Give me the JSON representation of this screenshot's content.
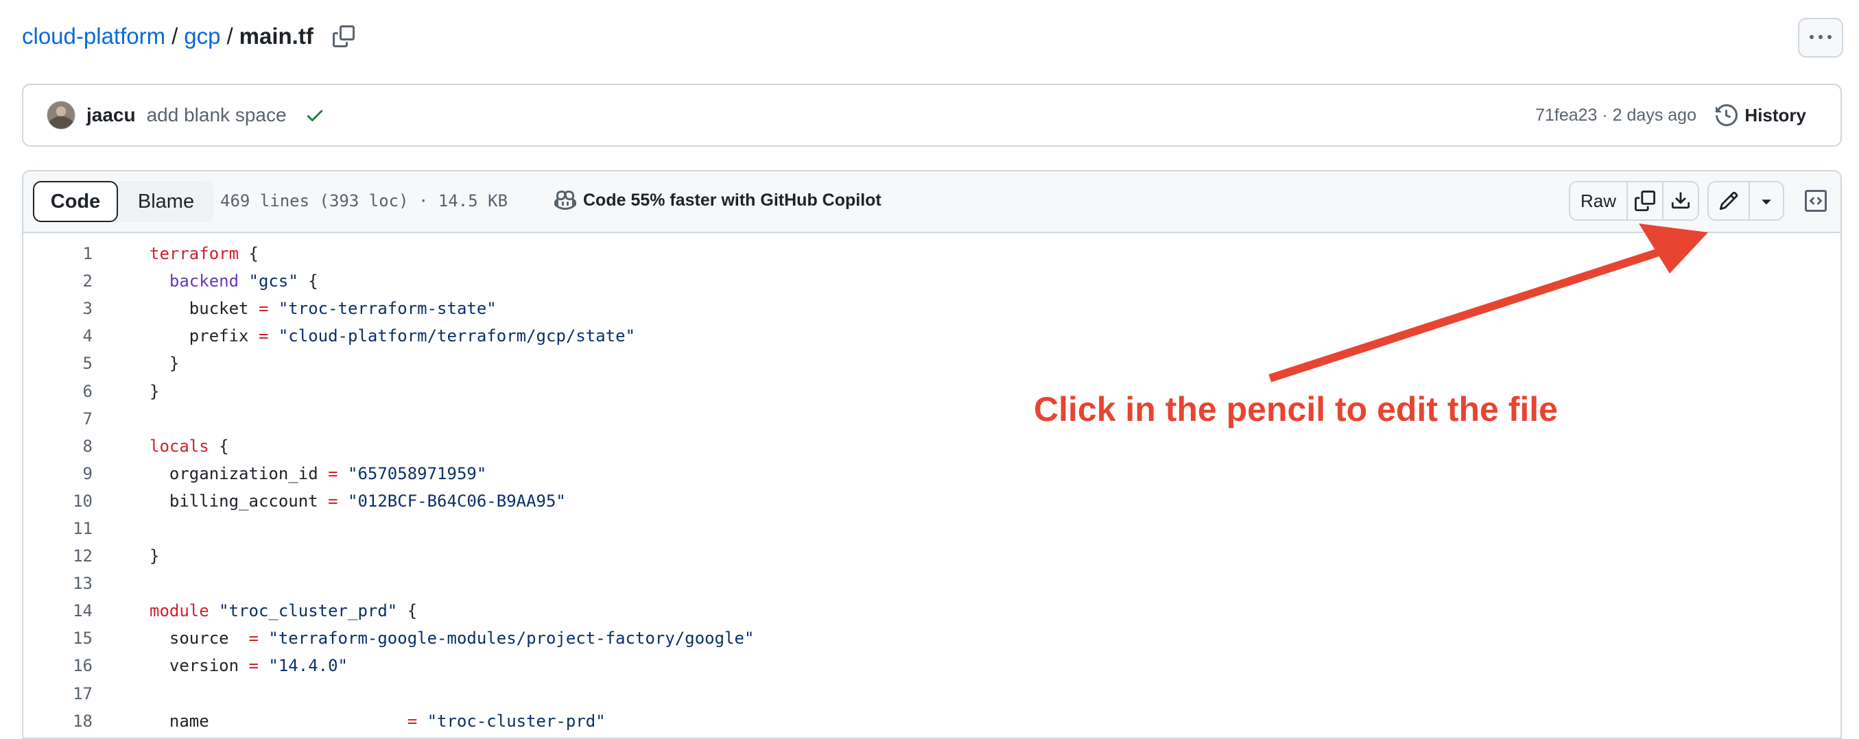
{
  "breadcrumb": {
    "repo": "cloud-platform",
    "folder": "gcp",
    "file": "main.tf",
    "separator": "/"
  },
  "commit": {
    "author": "jaacu",
    "message": "add blank space",
    "hash": "71fea23",
    "time": "2 days ago",
    "history_label": "History"
  },
  "viewer": {
    "tabs": {
      "code": "Code",
      "blame": "Blame"
    },
    "file_info": "469 lines (393 loc) · 14.5 KB",
    "copilot": "Code 55% faster with GitHub Copilot",
    "raw": "Raw"
  },
  "annotation": {
    "text": "Click in the pencil to edit the file",
    "color": "#e74531"
  },
  "colors": {
    "link": "#0969da",
    "keyword": "#cf222e",
    "block_label": "#6639ba",
    "string": "#0a3069",
    "check": "#1a7f37"
  },
  "icons": [
    "copy-icon",
    "kebab-icon",
    "check-icon",
    "history-icon",
    "copilot-icon",
    "copy-icon",
    "download-icon",
    "pencil-icon",
    "triangle-down-icon",
    "code-square-icon"
  ],
  "code": {
    "lines": [
      [
        [
          "terraform",
          "kw"
        ],
        [
          " {",
          ""
        ]
      ],
      [
        [
          "  ",
          ""
        ],
        [
          "backend",
          "fn"
        ],
        [
          " ",
          ""
        ],
        [
          "\"gcs\"",
          "str"
        ],
        [
          " {",
          ""
        ]
      ],
      [
        [
          "    bucket ",
          ""
        ],
        [
          "=",
          "kw"
        ],
        [
          " ",
          ""
        ],
        [
          "\"troc-terraform-state\"",
          "str"
        ]
      ],
      [
        [
          "    prefix ",
          ""
        ],
        [
          "=",
          "kw"
        ],
        [
          " ",
          ""
        ],
        [
          "\"cloud-platform/terraform/gcp/state\"",
          "str"
        ]
      ],
      [
        [
          "  }",
          ""
        ]
      ],
      [
        [
          "}",
          ""
        ]
      ],
      [],
      [
        [
          "locals",
          "kw"
        ],
        [
          " {",
          ""
        ]
      ],
      [
        [
          "  organization_id ",
          ""
        ],
        [
          "=",
          "kw"
        ],
        [
          " ",
          ""
        ],
        [
          "\"657058971959\"",
          "str"
        ]
      ],
      [
        [
          "  billing_account ",
          ""
        ],
        [
          "=",
          "kw"
        ],
        [
          " ",
          ""
        ],
        [
          "\"012BCF-B64C06-B9AA95\"",
          "str"
        ]
      ],
      [],
      [
        [
          "}",
          ""
        ]
      ],
      [],
      [
        [
          "module",
          "kw"
        ],
        [
          " ",
          ""
        ],
        [
          "\"troc_cluster_prd\"",
          "str"
        ],
        [
          " {",
          ""
        ]
      ],
      [
        [
          "  source  ",
          ""
        ],
        [
          "=",
          "kw"
        ],
        [
          " ",
          ""
        ],
        [
          "\"terraform-google-modules/project-factory/google\"",
          "str"
        ]
      ],
      [
        [
          "  version ",
          ""
        ],
        [
          "=",
          "kw"
        ],
        [
          " ",
          ""
        ],
        [
          "\"14.4.0\"",
          "str"
        ]
      ],
      [],
      [
        [
          "  name                    ",
          ""
        ],
        [
          "=",
          "kw"
        ],
        [
          " ",
          ""
        ],
        [
          "\"troc-cluster-prd\"",
          "str"
        ]
      ]
    ]
  }
}
